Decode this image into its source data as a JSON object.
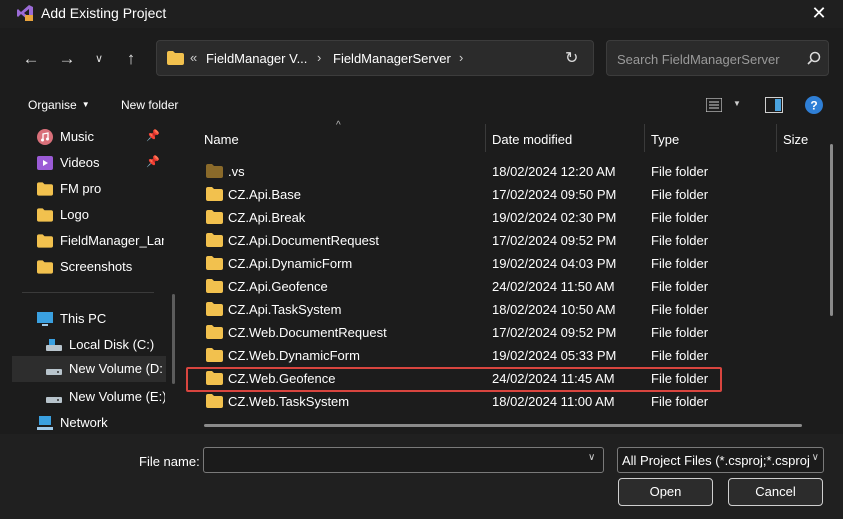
{
  "window": {
    "title": "Add Existing Project"
  },
  "address": {
    "overflow": "«",
    "crumbs": [
      "FieldManager V...",
      "FieldManagerServer"
    ]
  },
  "search": {
    "placeholder": "Search FieldManagerServer"
  },
  "toolbar": {
    "organise": "Organise",
    "new_folder": "New folder"
  },
  "sidebar": {
    "items": [
      {
        "label": "Music",
        "icon": "music-icon",
        "pinned": true
      },
      {
        "label": "Videos",
        "icon": "videos-icon",
        "pinned": true
      },
      {
        "label": "FM pro",
        "icon": "folder-icon",
        "pinned": false
      },
      {
        "label": "Logo",
        "icon": "folder-icon",
        "pinned": false
      },
      {
        "label": "FieldManager_Lar",
        "icon": "folder-icon",
        "pinned": false
      },
      {
        "label": "Screenshots",
        "icon": "folder-icon",
        "pinned": false
      },
      {
        "label": "This PC",
        "icon": "pc-icon",
        "pinned": false
      },
      {
        "label": "Local Disk (C:)",
        "icon": "drive-icon",
        "pinned": false
      },
      {
        "label": "New Volume (D:",
        "icon": "drive-icon",
        "pinned": false,
        "selected": true
      },
      {
        "label": "New Volume (E:)",
        "icon": "drive-icon",
        "pinned": false
      },
      {
        "label": "Network",
        "icon": "network-icon",
        "pinned": false
      }
    ]
  },
  "columns": {
    "name": "Name",
    "date": "Date modified",
    "type": "Type",
    "size": "Size"
  },
  "files": [
    {
      "name": ".vs",
      "date": "18/02/2024 12:20 AM",
      "type": "File folder"
    },
    {
      "name": "CZ.Api.Base",
      "date": "17/02/2024 09:50 PM",
      "type": "File folder"
    },
    {
      "name": "CZ.Api.Break",
      "date": "19/02/2024 02:30 PM",
      "type": "File folder"
    },
    {
      "name": "CZ.Api.DocumentRequest",
      "date": "17/02/2024 09:52 PM",
      "type": "File folder"
    },
    {
      "name": "CZ.Api.DynamicForm",
      "date": "19/02/2024 04:03 PM",
      "type": "File folder"
    },
    {
      "name": "CZ.Api.Geofence",
      "date": "24/02/2024 11:50 AM",
      "type": "File folder"
    },
    {
      "name": "CZ.Api.TaskSystem",
      "date": "18/02/2024 10:50 AM",
      "type": "File folder"
    },
    {
      "name": "CZ.Web.DocumentRequest",
      "date": "17/02/2024 09:52 PM",
      "type": "File folder"
    },
    {
      "name": "CZ.Web.DynamicForm",
      "date": "19/02/2024 05:33 PM",
      "type": "File folder"
    },
    {
      "name": "CZ.Web.Geofence",
      "date": "24/02/2024 11:45 AM",
      "type": "File folder",
      "highlighted": true
    },
    {
      "name": "CZ.Web.TaskSystem",
      "date": "18/02/2024 11:00 AM",
      "type": "File folder"
    }
  ],
  "bottom": {
    "file_name_label": "File name:",
    "file_name_value": "",
    "filter": "All Project Files (*.csproj;*.csproj",
    "open": "Open",
    "cancel": "Cancel"
  },
  "colors": {
    "highlight": "#d9453f",
    "folder": "#f2c14e",
    "background": "#1c1c1c"
  }
}
